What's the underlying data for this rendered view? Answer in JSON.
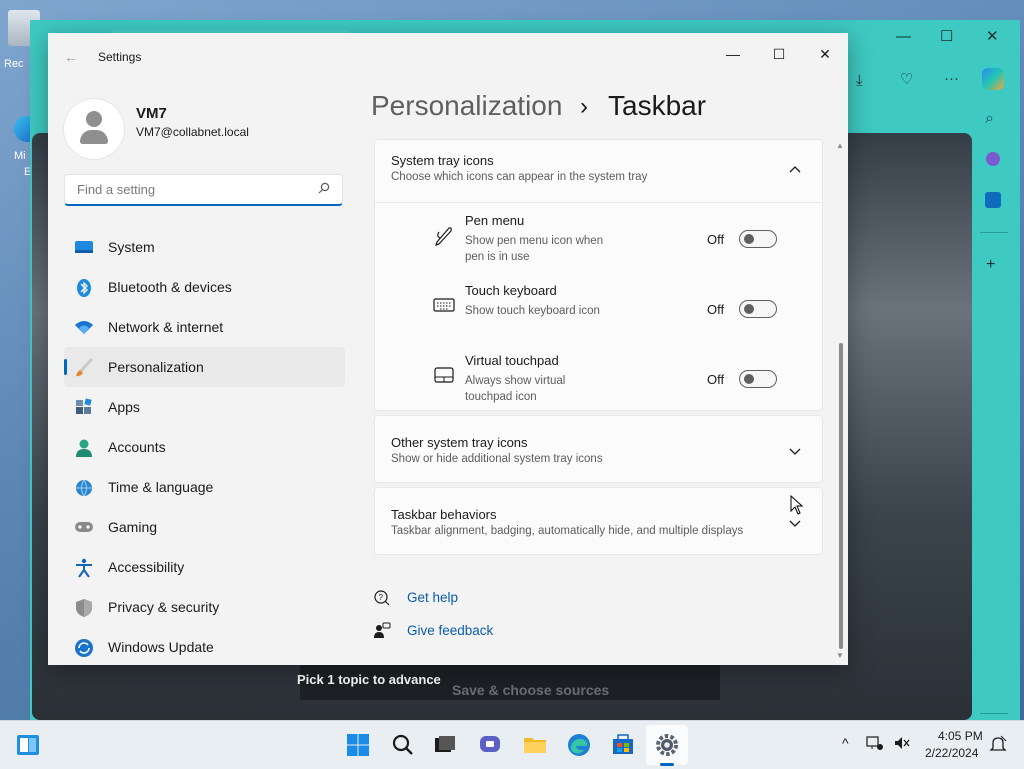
{
  "desktop": {
    "icon1_label": "Rec",
    "icon2_label": "Mi",
    "icon2_sub": "E"
  },
  "background_window": {
    "pick_text": "Pick 1 topic to advance",
    "save_text": "Save & choose sources",
    "accent": "#3ec9c2"
  },
  "settings": {
    "window_title": "Settings",
    "controls": {
      "minimize": "—",
      "maximize": "☐",
      "close": "✕"
    },
    "user": {
      "name": "VM7",
      "email": "VM7@collabnet.local"
    },
    "search": {
      "placeholder": "Find a setting",
      "value": ""
    },
    "nav": [
      {
        "label": "System",
        "icon": "system-icon",
        "color": "#0078d4"
      },
      {
        "label": "Bluetooth & devices",
        "icon": "bluetooth-icon",
        "color": "#0078d4"
      },
      {
        "label": "Network & internet",
        "icon": "wifi-icon",
        "color": "#0a64c8"
      },
      {
        "label": "Personalization",
        "icon": "brush-icon",
        "color": "#d1843a"
      },
      {
        "label": "Apps",
        "icon": "apps-icon",
        "color": "#4a6b8c"
      },
      {
        "label": "Accounts",
        "icon": "accounts-icon",
        "color": "#2aa587"
      },
      {
        "label": "Time & language",
        "icon": "globe-icon",
        "color": "#2a86d1"
      },
      {
        "label": "Gaming",
        "icon": "gamepad-icon",
        "color": "#7c7c7c"
      },
      {
        "label": "Accessibility",
        "icon": "accessibility-icon",
        "color": "#1166b8"
      },
      {
        "label": "Privacy & security",
        "icon": "shield-icon",
        "color": "#7d7d7d"
      },
      {
        "label": "Windows Update",
        "icon": "update-icon",
        "color": "#1a73c9"
      }
    ],
    "selected_nav": "Personalization",
    "breadcrumb": {
      "parent": "Personalization",
      "separator": "›",
      "current": "Taskbar"
    },
    "sections": {
      "system_tray": {
        "title": "System tray icons",
        "subtitle": "Choose which icons can appear in the system tray",
        "expanded": true,
        "items": [
          {
            "title": "Pen menu",
            "subtitle": "Show pen menu icon when pen is in use",
            "state": "Off",
            "icon": "pen-icon"
          },
          {
            "title": "Touch keyboard",
            "subtitle": "Show touch keyboard icon",
            "state": "Off",
            "icon": "keyboard-icon"
          },
          {
            "title": "Virtual touchpad",
            "subtitle": "Always show virtual touchpad icon",
            "state": "Off",
            "icon": "touchpad-icon"
          }
        ]
      },
      "other_tray": {
        "title": "Other system tray icons",
        "subtitle": "Show or hide additional system tray icons"
      },
      "behaviors": {
        "title": "Taskbar behaviors",
        "subtitle": "Taskbar alignment, badging, automatically hide, and multiple displays"
      }
    },
    "links": {
      "help": "Get help",
      "feedback": "Give feedback"
    }
  },
  "taskbar": {
    "apps": [
      "widgets-icon",
      "start-icon",
      "search-icon",
      "task-view-icon",
      "chat-icon",
      "file-explorer-icon",
      "edge-icon",
      "store-icon",
      "settings-icon"
    ],
    "time": "4:05 PM",
    "date": "2/22/2024"
  }
}
